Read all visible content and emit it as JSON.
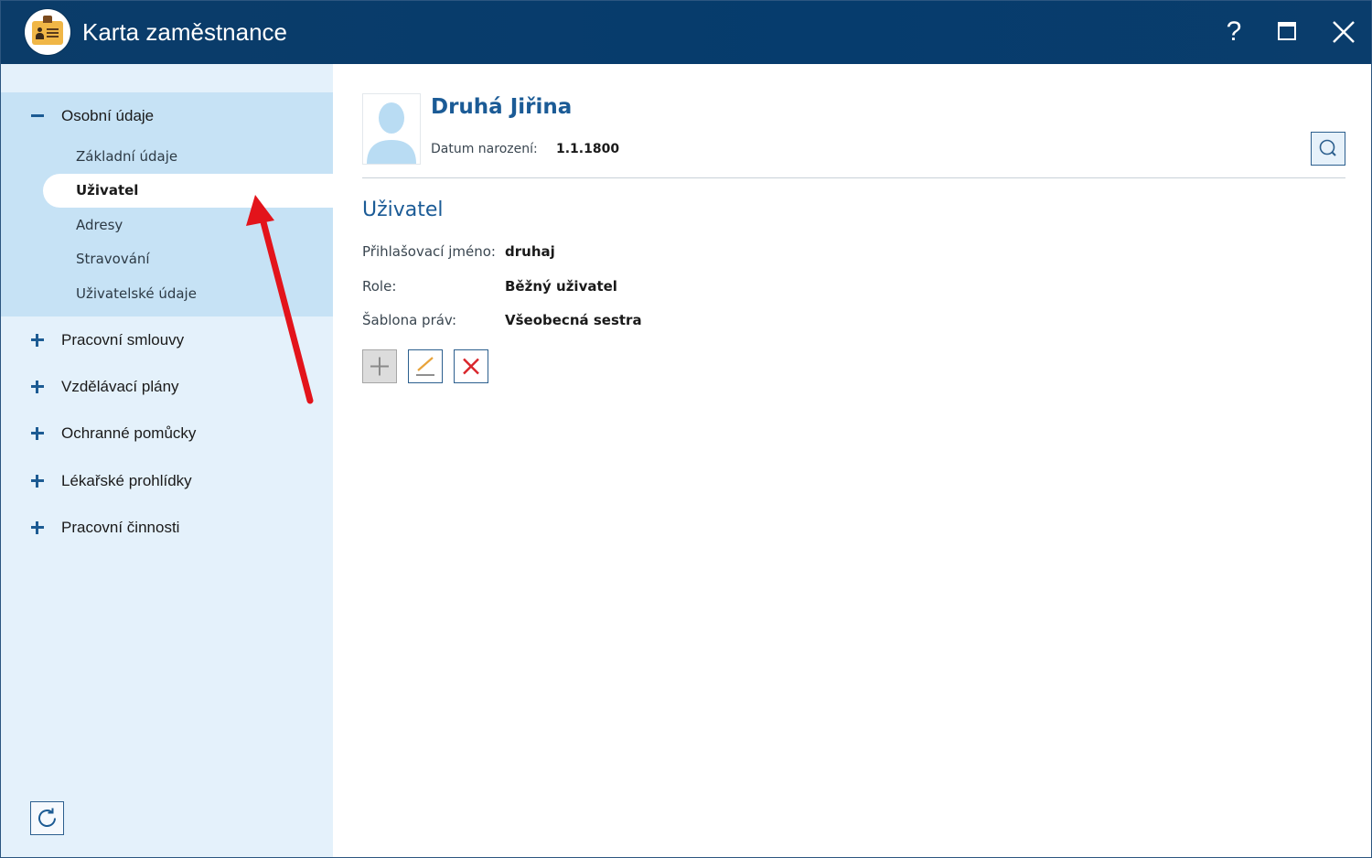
{
  "window": {
    "title": "Karta zaměstnance",
    "help_label": "?"
  },
  "sidebar": {
    "groups": [
      {
        "label": "Osobní údaje",
        "expanded": true,
        "items": [
          {
            "label": "Základní údaje",
            "active": false
          },
          {
            "label": "Uživatel",
            "active": true
          },
          {
            "label": "Adresy",
            "active": false
          },
          {
            "label": "Stravování",
            "active": false
          },
          {
            "label": "Uživatelské údaje",
            "active": false
          }
        ]
      },
      {
        "label": "Pracovní smlouvy",
        "expanded": false
      },
      {
        "label": "Vzdělávací plány",
        "expanded": false
      },
      {
        "label": "Ochranné pomůcky",
        "expanded": false
      },
      {
        "label": "Lékařské prohlídky",
        "expanded": false
      },
      {
        "label": "Pracovní činnosti",
        "expanded": false
      }
    ]
  },
  "employee": {
    "name": "Druhá Jiřina",
    "dob_label": "Datum narození:",
    "dob_value": "1.1.1800"
  },
  "section": {
    "title": "Uživatel",
    "fields": [
      {
        "label": "Přihlašovací jméno:",
        "value": "druhaj"
      },
      {
        "label": "Role:",
        "value": "Běžný uživatel"
      },
      {
        "label": "Šablona práv:",
        "value": "Všeobecná sestra"
      }
    ]
  },
  "icons": {
    "add": "plus-icon",
    "edit": "pencil-icon",
    "delete": "close-icon",
    "search": "search-icon",
    "refresh": "refresh-icon"
  },
  "colors": {
    "titlebar": "#063c6d",
    "accent": "#1b5b96",
    "sidebar": "#e4f1fb",
    "sidebar_expanded": "#c6e2f5",
    "delete": "#d9252b",
    "annotation_arrow": "#e3141b"
  }
}
